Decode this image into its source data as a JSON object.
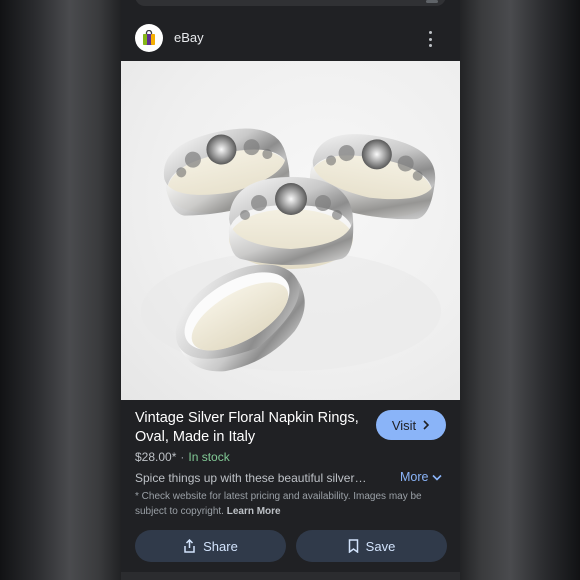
{
  "source": {
    "name": "eBay"
  },
  "product": {
    "title": "Vintage Silver Floral Napkin Rings, Oval, Made in Italy",
    "price": "$28.00*",
    "availability": "In stock",
    "description": "Spice things up with these beautiful silver…",
    "disclaimer_text": "* Check website for latest pricing and availability. Images may be subject to copyright.",
    "learn_more_label": "Learn More"
  },
  "actions": {
    "visit_label": "Visit",
    "more_label": "More",
    "share_label": "Share",
    "save_label": "Save"
  },
  "colors": {
    "accent": "#8ab4f8",
    "in_stock": "#81c995",
    "panel": "#202124",
    "button_bg": "#303a4a"
  },
  "icons": {
    "source_logo": "ebay-bag-icon",
    "menu": "more-vert-icon",
    "visit": "chevron-right-icon",
    "more": "chevron-down-icon",
    "share": "share-icon",
    "save": "bookmark-icon"
  }
}
